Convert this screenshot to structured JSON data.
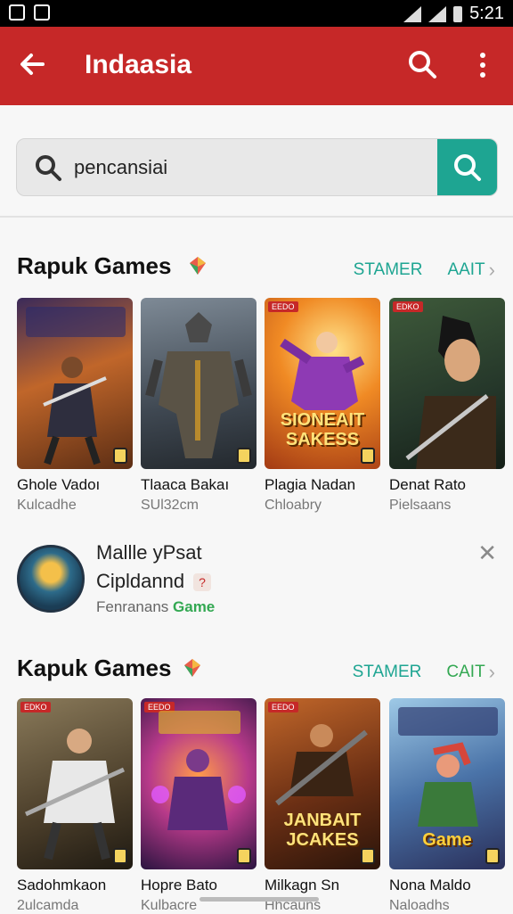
{
  "status_bar": {
    "time": "5:21"
  },
  "app_bar": {
    "title": "Indaasia"
  },
  "search": {
    "value": "pencansiai"
  },
  "sections": [
    {
      "title": "Rapuk Games",
      "link_a": "STAMER",
      "link_b": "AAIT",
      "cards": [
        {
          "name": "Ghole Vadoı",
          "sub": "Kulcadhe",
          "overlay": "",
          "tag": ""
        },
        {
          "name": "Tlaaca Bakaı",
          "sub": "SUl32cm",
          "overlay": "",
          "tag": ""
        },
        {
          "name": "Plagia Nadan",
          "sub": "Chloabry",
          "overlay": "SIONEAIT SAKESS",
          "tag": "EEDO"
        },
        {
          "name": "Denat Rato",
          "sub": "Pielsaans",
          "overlay": "",
          "tag": "EDKO"
        }
      ]
    },
    {
      "title": "Kapuk Games",
      "link_a": "STAMER",
      "link_b": "CAIT",
      "cards": [
        {
          "name": "Sadohmkaon",
          "sub": "2ulcamda",
          "overlay": "",
          "tag": "EDKO"
        },
        {
          "name": "Hopre Bato",
          "sub": "Kulbacre",
          "overlay": "",
          "tag": "EEDO"
        },
        {
          "name": "Milkagn Sn",
          "sub": "Hhcauns",
          "overlay": "JANBAIT JCAKES",
          "tag": "EEDO"
        },
        {
          "name": "Nona Maldo",
          "sub": "Naloadhs",
          "overlay": "Game",
          "tag": ""
        }
      ]
    }
  ],
  "promo": {
    "line1": "Mallle yPsat",
    "line2": "Cipldannd",
    "line3_prefix": "Fenranans",
    "line3_highlight": "Game"
  },
  "colors": {
    "primary": "#c62828",
    "accent": "#1ea592",
    "green": "#33a852"
  }
}
